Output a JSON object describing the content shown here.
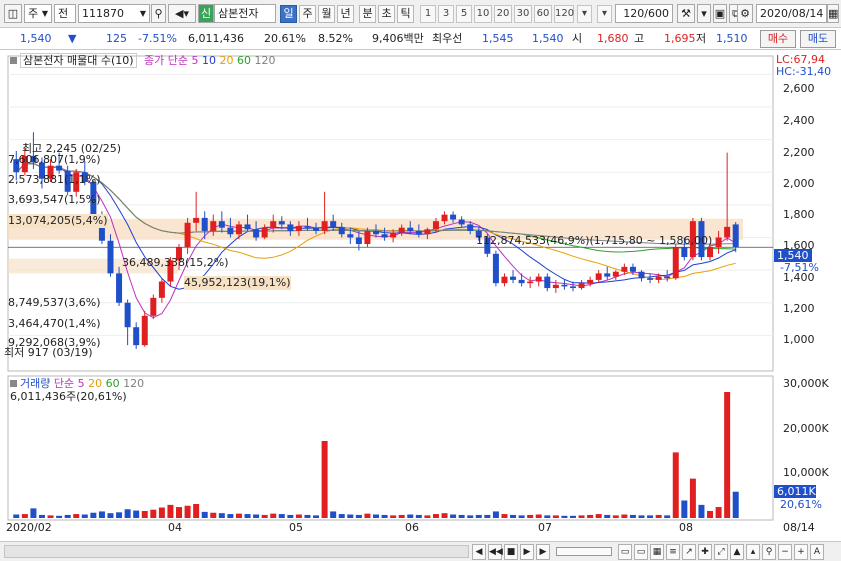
{
  "toolbar": {
    "market_type": "주",
    "market_type2": "전",
    "code": "111870",
    "search_icon": "search-icon",
    "badge": "신",
    "stock_name": "삼본전자",
    "periods": [
      "일",
      "주",
      "월",
      "년",
      "분",
      "초",
      "틱"
    ],
    "active_period": "일",
    "numbers": [
      "1",
      "3",
      "5",
      "10",
      "20",
      "30",
      "60",
      "120"
    ],
    "count_display": "120/600",
    "date": "2020/08/14"
  },
  "quote": {
    "price": "1,540",
    "change_arrow": "▼",
    "change": "125",
    "change_pct": "-7.51%",
    "volume": "6,011,436",
    "turnover_pct": "20.61%",
    "ratio": "8.52%",
    "amount": "9,406백만",
    "best_ask_label": "최우선",
    "best_ask": "1,545",
    "best_bid": "1,540",
    "open_label": "시",
    "open": "1,680",
    "high_label": "고",
    "high": "1,695",
    "low_label": "저",
    "low": "1,510",
    "buy_label": "매수",
    "sell_label": "매도"
  },
  "price_legend": {
    "name": "삼본전자 매물대 수(10)",
    "ma_label": "종가 단순",
    "ma": [
      "5",
      "10",
      "20",
      "60",
      "120"
    ],
    "lc": "LC:67,94",
    "hc": "HC:-31,40"
  },
  "volume_legend": {
    "name": "거래량",
    "ma_label": "단순",
    "ma": [
      "5",
      "20",
      "60",
      "120"
    ],
    "value": "6,011,436주(20,61%)"
  },
  "annotations": {
    "high": "최고 2,245 (02/25)",
    "low": "최저 917 (03/19)",
    "profiles": [
      "7,606,807(1,9%)",
      "2,573,881(1,1%)",
      "3,693,547(1,5%)",
      "13,074,205(5,4%)",
      "36,489,338(15,2%)",
      "45,952,123(19,1%)",
      "8,749,537(3,6%)",
      "3,464,470(1,4%)",
      "9,292,068(3,9%)",
      "112,874,533(46,9%)(1,715,80 ~ 1,586,00)"
    ]
  },
  "axis": {
    "price_ticks": [
      "2,600",
      "2,400",
      "2,200",
      "2,000",
      "1,800",
      "1,600",
      "1,400",
      "1,200",
      "1,000"
    ],
    "volume_ticks": [
      "30,000K",
      "20,000K",
      "10,000K"
    ],
    "current_price_tag": "1,540",
    "current_change_tag": "-7,51%",
    "current_volume_tag": "6,011K",
    "current_volume_pct": "20,61%",
    "x_labels": [
      "2020/02",
      "04",
      "05",
      "06",
      "07",
      "08"
    ],
    "right_date": "08/14"
  },
  "colors": {
    "up": "#e02020",
    "down": "#1f4fc9",
    "ma5": "#c030c0",
    "ma10": "#1f3fd0",
    "ma20": "#e8a000",
    "ma60": "#2ca02c",
    "ma120": "#808080",
    "profile": "#f7dcc0"
  },
  "chart_data": {
    "type": "candlestick",
    "title": "삼본전자",
    "price_ylim": [
      800,
      2700
    ],
    "volume_ylim": [
      0,
      32000
    ],
    "ohlc": [
      [
        2080,
        2130,
        1950,
        2000
      ],
      [
        2000,
        2150,
        1980,
        2100
      ],
      [
        2100,
        2245,
        2020,
        2060
      ],
      [
        2060,
        2090,
        1900,
        1960
      ],
      [
        1960,
        2080,
        1940,
        2040
      ],
      [
        2040,
        2120,
        1990,
        2010
      ],
      [
        2010,
        2040,
        1860,
        1880
      ],
      [
        1880,
        2020,
        1850,
        2000
      ],
      [
        2000,
        2070,
        1920,
        1940
      ],
      [
        1940,
        1950,
        1700,
        1720
      ],
      [
        1720,
        1760,
        1560,
        1580
      ],
      [
        1580,
        1620,
        1360,
        1380
      ],
      [
        1380,
        1420,
        1180,
        1200
      ],
      [
        1200,
        1220,
        940,
        1050
      ],
      [
        1050,
        1080,
        917,
        940
      ],
      [
        940,
        1150,
        930,
        1120
      ],
      [
        1120,
        1250,
        1100,
        1230
      ],
      [
        1230,
        1350,
        1200,
        1330
      ],
      [
        1330,
        1480,
        1300,
        1460
      ],
      [
        1460,
        1560,
        1400,
        1540
      ],
      [
        1540,
        1720,
        1500,
        1690
      ],
      [
        1690,
        1880,
        1640,
        1720
      ],
      [
        1720,
        1760,
        1590,
        1640
      ],
      [
        1640,
        1740,
        1610,
        1700
      ],
      [
        1700,
        1760,
        1630,
        1660
      ],
      [
        1660,
        1720,
        1600,
        1620
      ],
      [
        1620,
        1700,
        1590,
        1680
      ],
      [
        1680,
        1740,
        1640,
        1650
      ],
      [
        1650,
        1700,
        1580,
        1600
      ],
      [
        1600,
        1680,
        1590,
        1660
      ],
      [
        1660,
        1740,
        1630,
        1700
      ],
      [
        1700,
        1730,
        1650,
        1680
      ],
      [
        1680,
        1700,
        1610,
        1640
      ],
      [
        1640,
        1700,
        1610,
        1670
      ],
      [
        1670,
        1720,
        1640,
        1660
      ],
      [
        1660,
        1690,
        1620,
        1640
      ],
      [
        1640,
        1880,
        1620,
        1700
      ],
      [
        1700,
        1740,
        1640,
        1660
      ],
      [
        1660,
        1690,
        1600,
        1620
      ],
      [
        1620,
        1660,
        1560,
        1600
      ],
      [
        1600,
        1640,
        1520,
        1560
      ],
      [
        1560,
        1660,
        1540,
        1640
      ],
      [
        1640,
        1680,
        1600,
        1620
      ],
      [
        1620,
        1660,
        1580,
        1600
      ],
      [
        1600,
        1650,
        1570,
        1630
      ],
      [
        1630,
        1680,
        1610,
        1660
      ],
      [
        1660,
        1700,
        1620,
        1640
      ],
      [
        1640,
        1680,
        1600,
        1620
      ],
      [
        1620,
        1660,
        1590,
        1650
      ],
      [
        1650,
        1720,
        1630,
        1700
      ],
      [
        1700,
        1760,
        1680,
        1740
      ],
      [
        1740,
        1760,
        1690,
        1710
      ],
      [
        1710,
        1730,
        1660,
        1680
      ],
      [
        1680,
        1700,
        1620,
        1640
      ],
      [
        1640,
        1660,
        1580,
        1600
      ],
      [
        1600,
        1620,
        1480,
        1500
      ],
      [
        1500,
        1520,
        1300,
        1320
      ],
      [
        1320,
        1380,
        1300,
        1360
      ],
      [
        1360,
        1400,
        1320,
        1340
      ],
      [
        1340,
        1380,
        1300,
        1320
      ],
      [
        1320,
        1360,
        1290,
        1330
      ],
      [
        1330,
        1380,
        1300,
        1360
      ],
      [
        1360,
        1380,
        1270,
        1290
      ],
      [
        1290,
        1340,
        1260,
        1310
      ],
      [
        1310,
        1340,
        1280,
        1300
      ],
      [
        1300,
        1330,
        1270,
        1290
      ],
      [
        1290,
        1340,
        1280,
        1320
      ],
      [
        1320,
        1360,
        1300,
        1340
      ],
      [
        1340,
        1400,
        1320,
        1380
      ],
      [
        1380,
        1420,
        1340,
        1360
      ],
      [
        1360,
        1400,
        1340,
        1390
      ],
      [
        1390,
        1440,
        1370,
        1420
      ],
      [
        1420,
        1440,
        1370,
        1390
      ],
      [
        1390,
        1400,
        1330,
        1350
      ],
      [
        1350,
        1380,
        1320,
        1340
      ],
      [
        1340,
        1380,
        1320,
        1360
      ],
      [
        1360,
        1400,
        1330,
        1350
      ],
      [
        1350,
        1560,
        1340,
        1540
      ],
      [
        1540,
        1600,
        1460,
        1480
      ],
      [
        1480,
        1720,
        1460,
        1700
      ],
      [
        1700,
        1720,
        1460,
        1480
      ],
      [
        1480,
        1560,
        1460,
        1540
      ],
      [
        1540,
        1640,
        1500,
        1600
      ],
      [
        1600,
        2120,
        1580,
        1665
      ],
      [
        1680,
        1695,
        1510,
        1540
      ]
    ],
    "volume": [
      800,
      900,
      2200,
      700,
      600,
      500,
      700,
      900,
      800,
      1200,
      1500,
      1100,
      1300,
      2000,
      1700,
      1600,
      1900,
      2400,
      3000,
      2500,
      2800,
      3200,
      1400,
      1200,
      1100,
      900,
      1000,
      900,
      800,
      700,
      1000,
      900,
      700,
      800,
      700,
      600,
      17600,
      1500,
      900,
      800,
      700,
      1000,
      800,
      700,
      600,
      700,
      800,
      700,
      600,
      900,
      1100,
      800,
      700,
      600,
      700,
      700,
      1500,
      900,
      700,
      600,
      700,
      800,
      600,
      600,
      500,
      500,
      600,
      700,
      900,
      700,
      600,
      800,
      700,
      600,
      600,
      700,
      600,
      15000,
      4000,
      9000,
      3000,
      1600,
      2500,
      28800,
      6011
    ]
  }
}
